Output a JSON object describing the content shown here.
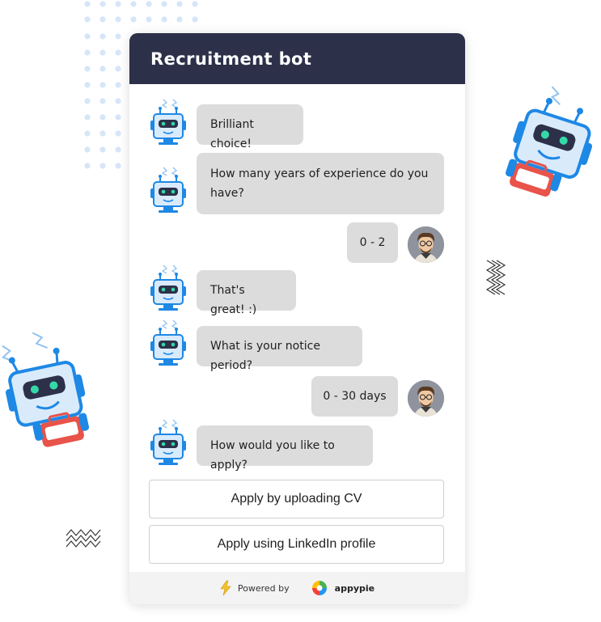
{
  "chat": {
    "title": "Recruitment bot",
    "messages": [
      {
        "sender": "bot",
        "text": "Brilliant choice!"
      },
      {
        "sender": "bot",
        "text": "How many years of experience do you have?"
      },
      {
        "sender": "user",
        "text": "0 - 2"
      },
      {
        "sender": "bot",
        "text": "That's great! :)"
      },
      {
        "sender": "bot",
        "text": "What is your notice period?"
      },
      {
        "sender": "user",
        "text": "0 - 30 days"
      },
      {
        "sender": "bot",
        "text": "How would you like to apply?"
      }
    ],
    "options": [
      {
        "label": "Apply by uploading CV"
      },
      {
        "label": "Apply using LinkedIn profile"
      }
    ]
  },
  "footer": {
    "powered_by": "Powered by",
    "brand": "appypie"
  },
  "colors": {
    "header_bg": "#2c3049",
    "bubble_bg": "#dcdcdc",
    "robot_blue": "#1e88e5",
    "briefcase_red": "#e8534a"
  },
  "icons": {
    "bot": "robot-icon",
    "user": "user-avatar-icon",
    "powered": "lightning-icon",
    "brand": "appypie-logo-icon"
  }
}
